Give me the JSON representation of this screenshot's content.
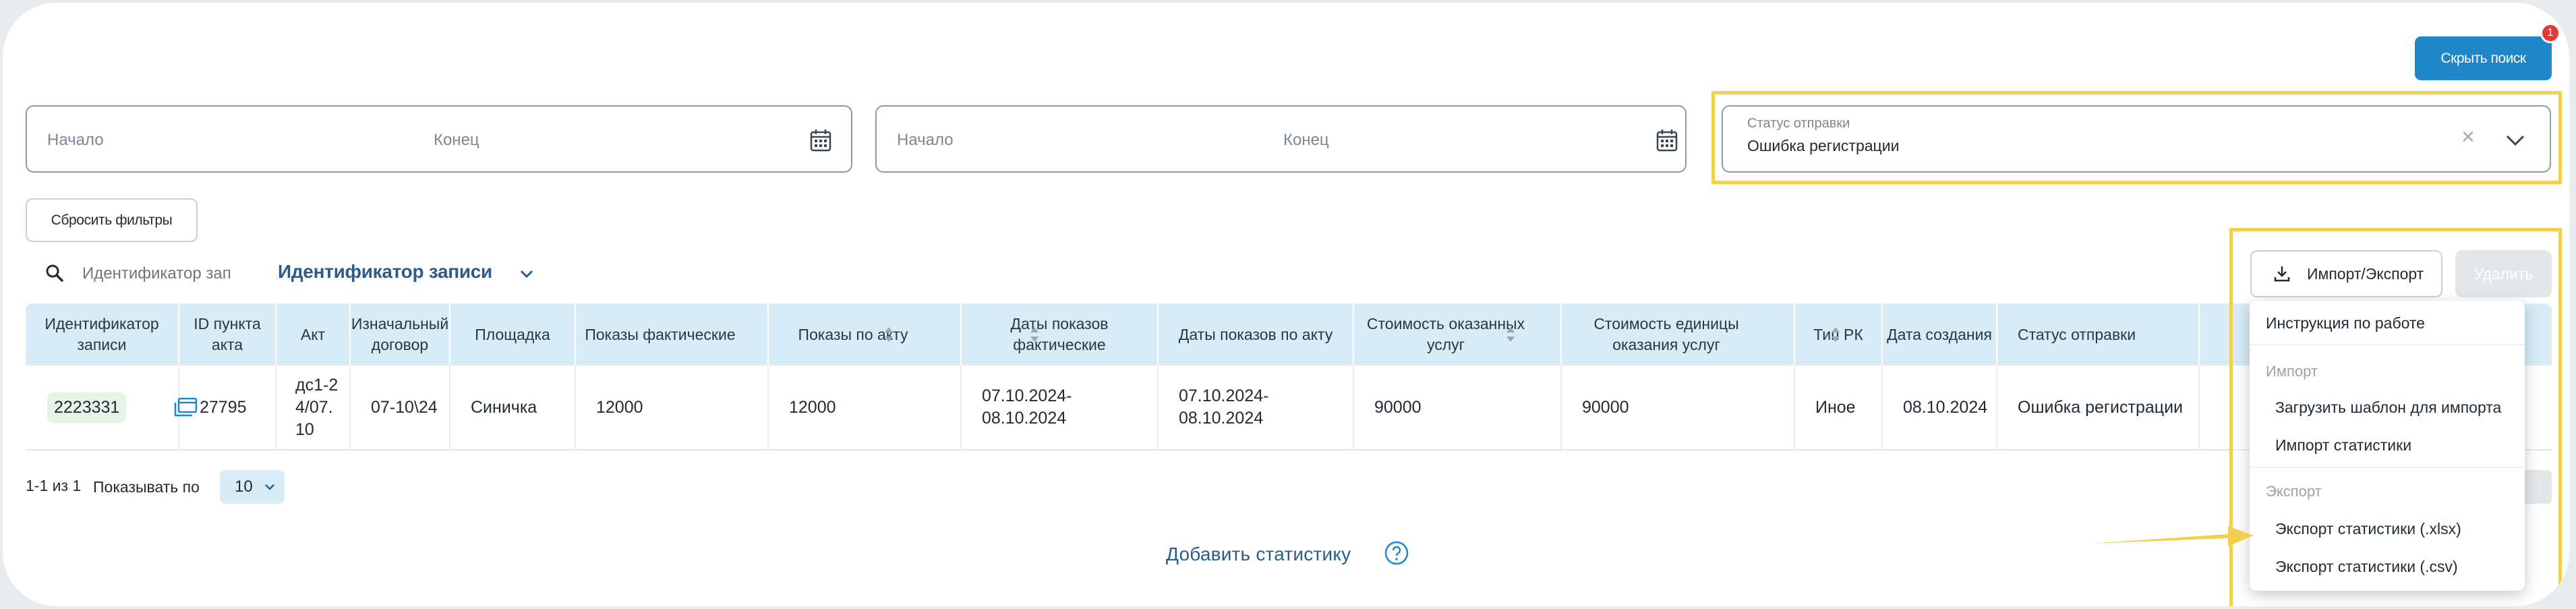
{
  "header": {
    "hide_search_label": "Скрыть поиск",
    "notification_count": "1"
  },
  "filters": {
    "range1": {
      "start_placeholder": "Начало",
      "end_placeholder": "Конец"
    },
    "range2": {
      "start_placeholder": "Начало",
      "end_placeholder": "Конец"
    },
    "status": {
      "label": "Статус отправки",
      "value": "Ошибка регистрации",
      "clear_symbol": "×"
    },
    "reset_label": "Сбросить фильтры"
  },
  "search": {
    "placeholder": "Идентификатор зап",
    "field_label": "Идентификатор записи"
  },
  "toolbar": {
    "import_export_label": "Импорт/Экспорт",
    "delete_label": "Удалить"
  },
  "table": {
    "columns": [
      "Идентификатор записи",
      "ID пункта акта",
      "Акт",
      "Изначальный договор",
      "Площадка",
      "Показы фактические",
      "Показы по акту",
      "Даты показов фактические",
      "Даты показов по акту",
      "Стоимость оказанных услуг",
      "Стоимость единицы оказания услуг",
      "Тип РК",
      "Дата создания",
      "Статус отправки"
    ],
    "row": [
      "2223331",
      "27795",
      "дс1-24/07.10",
      "07-10\\24",
      "Синичка",
      "12000",
      "12000",
      "07.10.2024-08.10.2024",
      "07.10.2024-08.10.2024",
      "90000",
      "90000",
      "Иное",
      "08.10.2024",
      "Ошибка регистрации"
    ]
  },
  "pagination": {
    "count": "1-1 из 1",
    "per_page_label": "Показывать по",
    "per_page_value": "10"
  },
  "footer": {
    "add_statistics_label": "Добавить статистику"
  },
  "menu": {
    "instruction": "Инструкция по работе",
    "import_group": "Импорт",
    "import_items": [
      "Загрузить шаблон для импорта",
      "Импорт статистики"
    ],
    "export_group": "Экспорт",
    "export_items": [
      "Экспорт статистики (.xlsx)",
      "Экспорт статистики (.csv)"
    ]
  },
  "colors": {
    "accent": "#1f87c8",
    "highlight": "#f2cf4f",
    "header_bg": "#d8ecf7",
    "link": "#2b5c8a"
  }
}
